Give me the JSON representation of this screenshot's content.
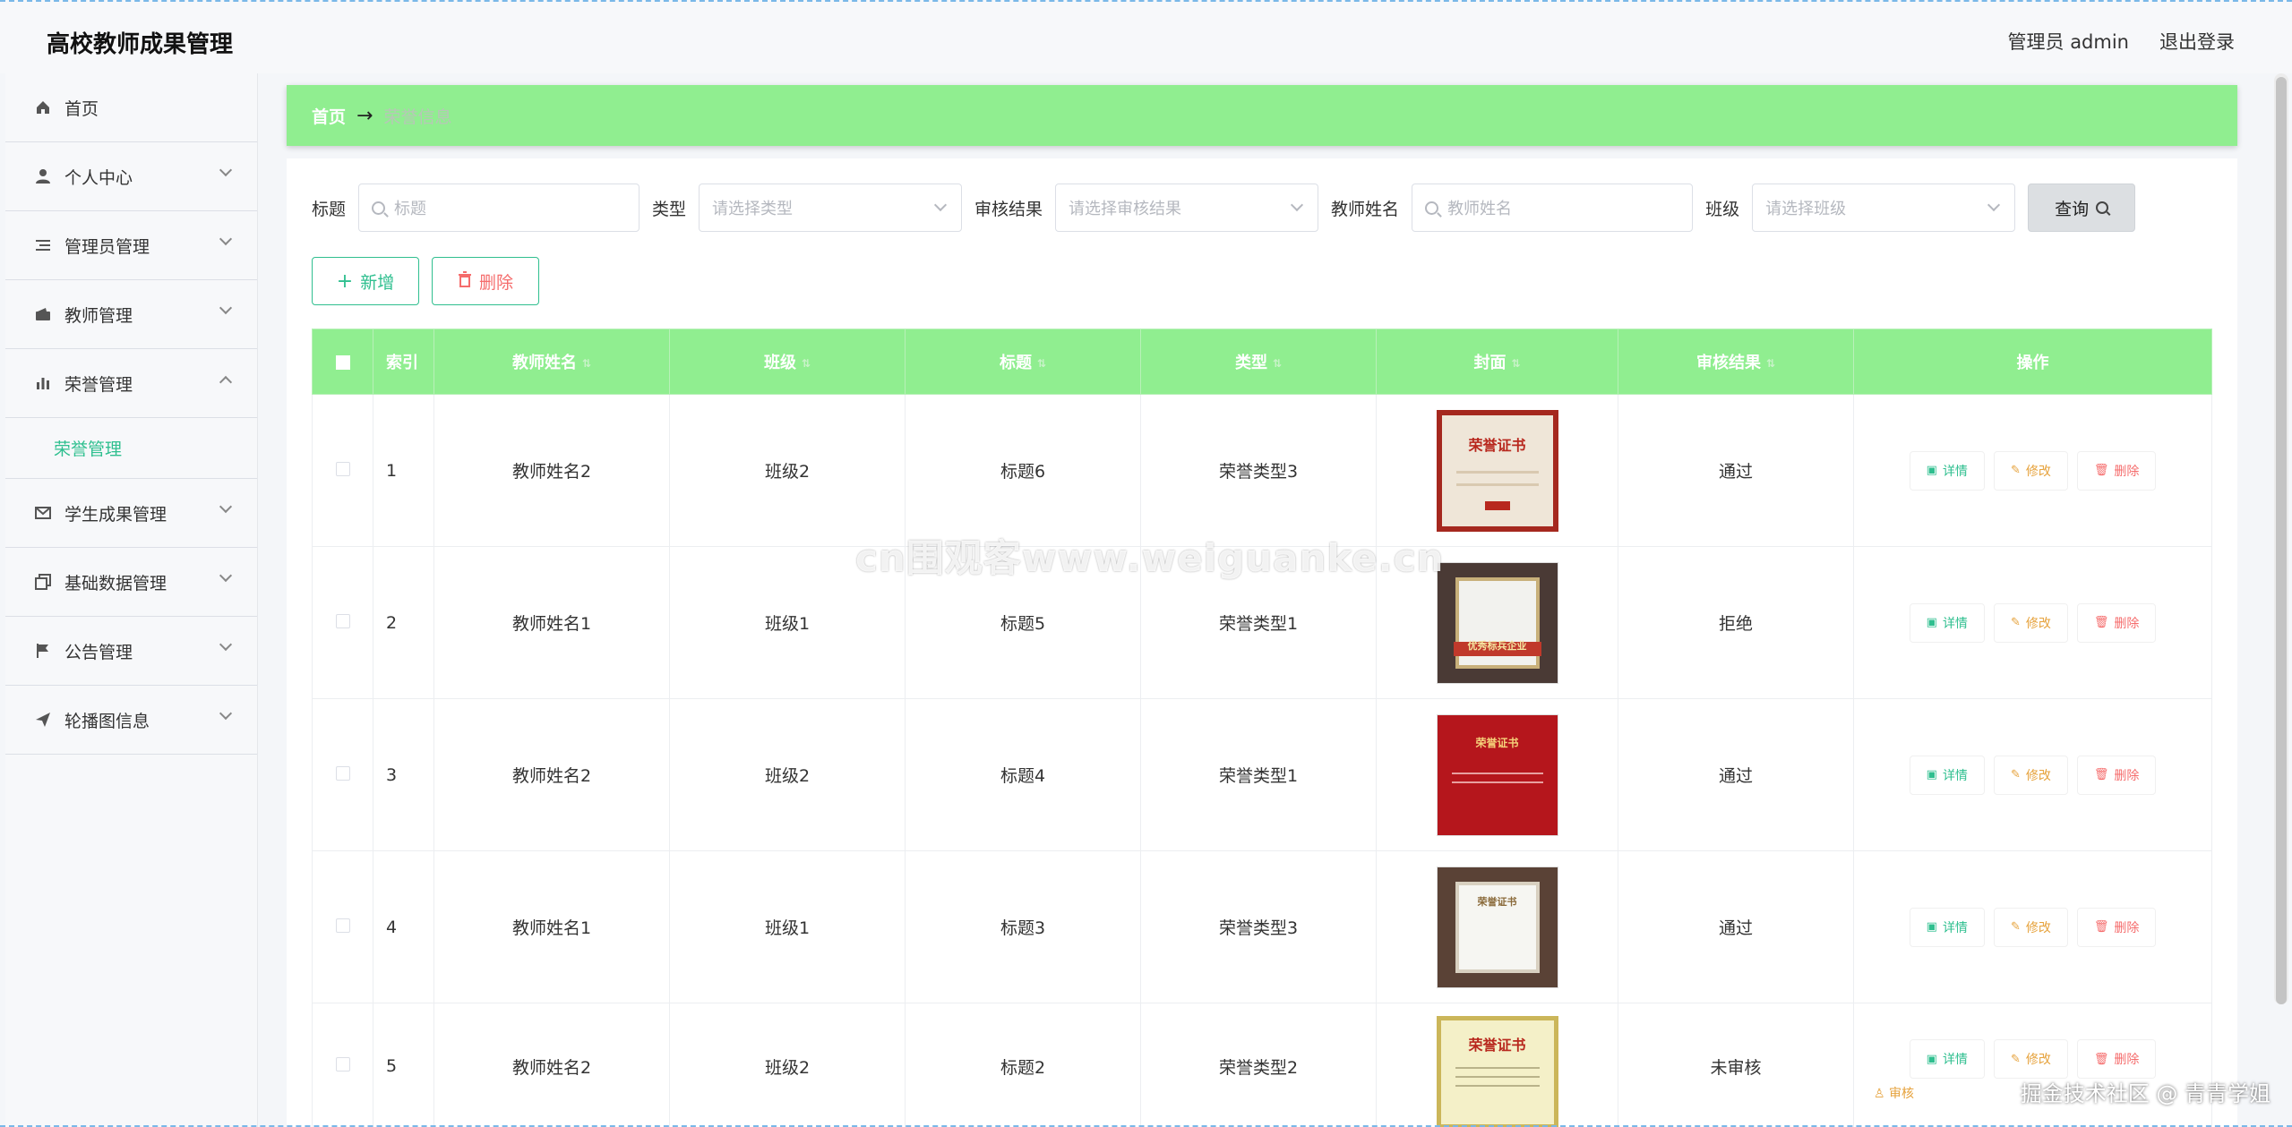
{
  "header": {
    "app_title": "高校教师成果管理",
    "user_label": "管理员 admin",
    "logout_label": "退出登录"
  },
  "sidebar": {
    "items": [
      {
        "label": "首页",
        "icon": "home-icon"
      },
      {
        "label": "个人中心",
        "icon": "user-icon"
      },
      {
        "label": "管理员管理",
        "icon": "list-icon"
      },
      {
        "label": "教师管理",
        "icon": "wallet-icon"
      },
      {
        "label": "荣誉管理",
        "icon": "bar-chart-icon"
      },
      {
        "label": "学生成果管理",
        "icon": "mail-icon"
      },
      {
        "label": "基础数据管理",
        "icon": "copy-icon"
      },
      {
        "label": "公告管理",
        "icon": "flag-icon"
      },
      {
        "label": "轮播图信息",
        "icon": "send-icon"
      }
    ],
    "active_sub": "荣誉管理"
  },
  "breadcrumb": {
    "home": "首页",
    "current": "荣誉信息"
  },
  "filters": {
    "title_label": "标题",
    "title_placeholder": "标题",
    "type_label": "类型",
    "type_placeholder": "请选择类型",
    "audit_label": "审核结果",
    "audit_placeholder": "请选择审核结果",
    "teacher_label": "教师姓名",
    "teacher_placeholder": "教师姓名",
    "class_label": "班级",
    "class_placeholder": "请选择班级",
    "query_label": "查询"
  },
  "actions": {
    "add_label": "新增",
    "delete_label": "删除"
  },
  "table": {
    "columns": [
      "索引",
      "教师姓名",
      "班级",
      "标题",
      "类型",
      "封面",
      "审核结果",
      "操作"
    ],
    "rows": [
      {
        "index": "1",
        "teacher": "教师姓名2",
        "class": "班级2",
        "title": "标题6",
        "type": "荣誉类型3",
        "audit": "通过",
        "cover_text": "荣誉证书"
      },
      {
        "index": "2",
        "teacher": "教师姓名1",
        "class": "班级1",
        "title": "标题5",
        "type": "荣誉类型1",
        "audit": "拒绝",
        "cover_text": "优秀标兵企业"
      },
      {
        "index": "3",
        "teacher": "教师姓名2",
        "class": "班级2",
        "title": "标题4",
        "type": "荣誉类型1",
        "audit": "通过",
        "cover_text": "荣誉证书"
      },
      {
        "index": "4",
        "teacher": "教师姓名1",
        "class": "班级1",
        "title": "标题3",
        "type": "荣誉类型3",
        "audit": "通过",
        "cover_text": "荣誉证书"
      },
      {
        "index": "5",
        "teacher": "教师姓名2",
        "class": "班级2",
        "title": "标题2",
        "type": "荣誉类型2",
        "audit": "未审核",
        "cover_text": "荣誉证书"
      }
    ],
    "op_detail": "详情",
    "op_edit": "修改",
    "op_delete": "删除",
    "op_audit": "审核"
  },
  "overlays": {
    "watermark": "cn围观客www.weiguanke.cn",
    "corner": "掘金技术社区 @ 青青学姐"
  },
  "colors": {
    "accent": "#90ee90",
    "primary": "#2fbf8f",
    "danger": "#f56c6c",
    "warning": "#e6a23c"
  }
}
